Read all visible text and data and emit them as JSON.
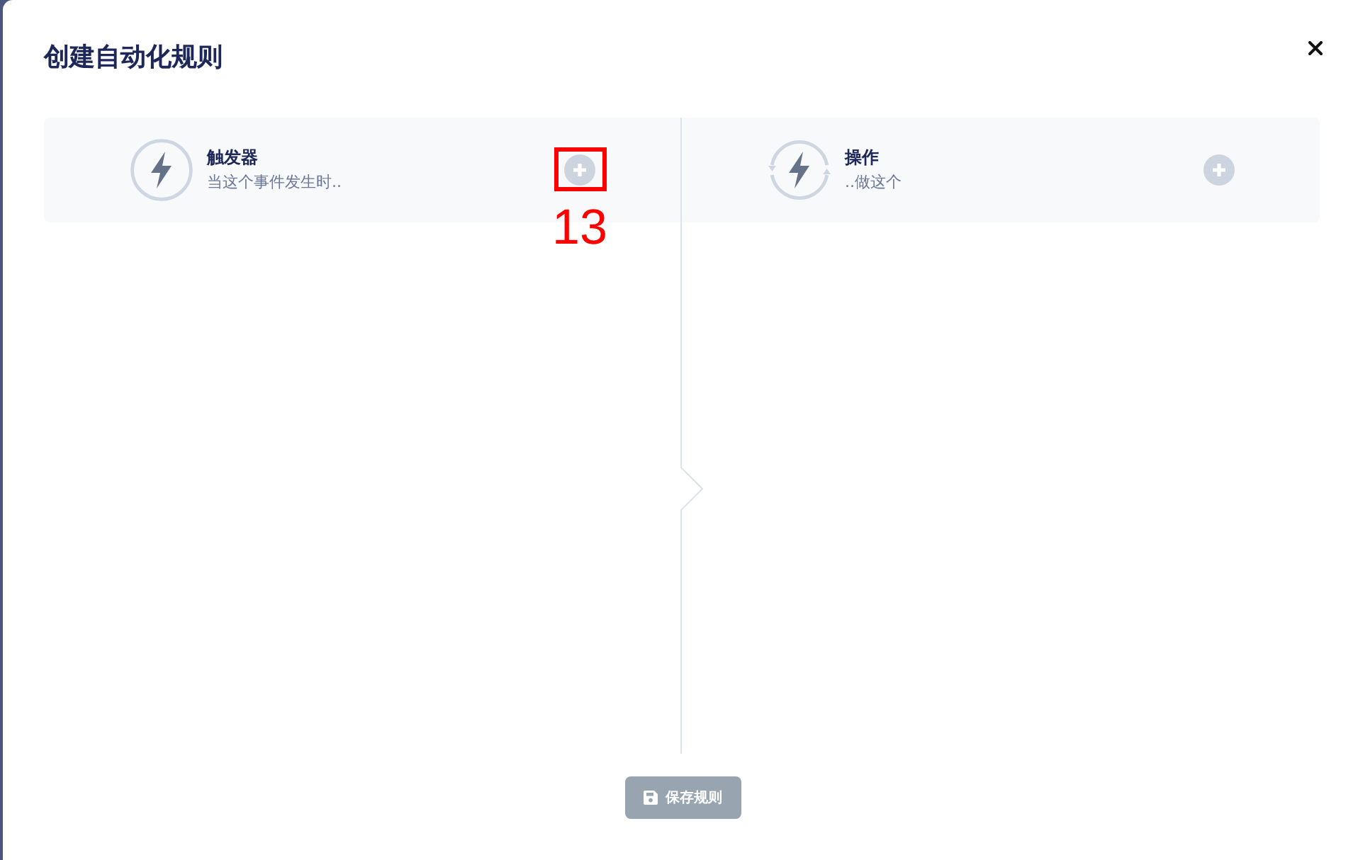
{
  "dialog": {
    "title": "创建自动化规则"
  },
  "panels": [
    {
      "kind": "trigger",
      "title": "触发器",
      "subtitle": "当这个事件发生时..",
      "annotation": "13"
    },
    {
      "kind": "action",
      "title": "操作",
      "subtitle": "..做这个"
    }
  ],
  "save_button": {
    "label": "保存规则",
    "disabled": true
  }
}
